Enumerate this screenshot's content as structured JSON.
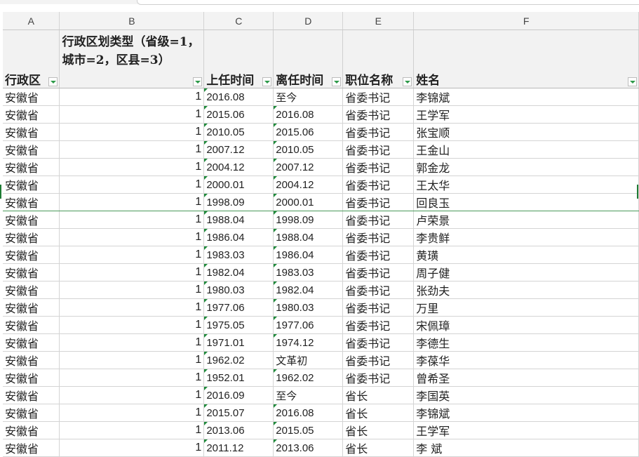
{
  "columns": [
    "A",
    "B",
    "C",
    "D",
    "E",
    "F"
  ],
  "headers": {
    "a": "行政区",
    "b": "行政区划类型（省级=1，城市=2，区县=3）",
    "c": "上任时间",
    "d": "离任时间",
    "e": "职位名称",
    "f": "姓名"
  },
  "rows": [
    {
      "region": "安徽省",
      "type": "1",
      "start": "2016.08",
      "end": "至今",
      "position": "省委书记",
      "name": "李锦斌"
    },
    {
      "region": "安徽省",
      "type": "1",
      "start": "2015.06",
      "end": "2016.08",
      "position": "省委书记",
      "name": "王学军"
    },
    {
      "region": "安徽省",
      "type": "1",
      "start": "2010.05",
      "end": "2015.06",
      "position": "省委书记",
      "name": "张宝顺"
    },
    {
      "region": "安徽省",
      "type": "1",
      "start": "2007.12",
      "end": "2010.05",
      "position": "省委书记",
      "name": "王金山"
    },
    {
      "region": "安徽省",
      "type": "1",
      "start": "2004.12",
      "end": "2007.12",
      "position": "省委书记",
      "name": "郭金龙"
    },
    {
      "region": "安徽省",
      "type": "1",
      "start": "2000.01",
      "end": "2004.12",
      "position": "省委书记",
      "name": "王太华"
    },
    {
      "region": "安徽省",
      "type": "1",
      "start": "1998.09",
      "end": "2000.01",
      "position": "省委书记",
      "name": "回良玉"
    },
    {
      "region": "安徽省",
      "type": "1",
      "start": "1988.04",
      "end": "1998.09",
      "position": "省委书记",
      "name": "卢荣景"
    },
    {
      "region": "安徽省",
      "type": "1",
      "start": "1986.04",
      "end": "1988.04",
      "position": "省委书记",
      "name": "李贵鲜"
    },
    {
      "region": "安徽省",
      "type": "1",
      "start": "1983.03",
      "end": "1986.04",
      "position": "省委书记",
      "name": "黄璜"
    },
    {
      "region": "安徽省",
      "type": "1",
      "start": "1982.04",
      "end": "1983.03",
      "position": "省委书记",
      "name": "周子健"
    },
    {
      "region": "安徽省",
      "type": "1",
      "start": "1980.03",
      "end": "1982.04",
      "position": "省委书记",
      "name": "张劲夫"
    },
    {
      "region": "安徽省",
      "type": "1",
      "start": "1977.06",
      "end": "1980.03",
      "position": "省委书记",
      "name": "万里"
    },
    {
      "region": "安徽省",
      "type": "1",
      "start": "1975.05",
      "end": "1977.06",
      "position": "省委书记",
      "name": "宋佩璋"
    },
    {
      "region": "安徽省",
      "type": "1",
      "start": "1971.01",
      "end": "1974.12",
      "position": "省委书记",
      "name": "李德生"
    },
    {
      "region": "安徽省",
      "type": "1",
      "start": "1962.02",
      "end": "文革初",
      "position": "省委书记",
      "name": "李葆华"
    },
    {
      "region": "安徽省",
      "type": "1",
      "start": "1952.01",
      "end": "1962.02",
      "position": "省委书记",
      "name": "曾希圣"
    },
    {
      "region": "安徽省",
      "type": "1",
      "start": "2016.09",
      "end": "至今",
      "position": "省长",
      "name": "李国英"
    },
    {
      "region": "安徽省",
      "type": "1",
      "start": "2015.07",
      "end": "2016.08",
      "position": "省长",
      "name": "李锦斌"
    },
    {
      "region": "安徽省",
      "type": "1",
      "start": "2013.06",
      "end": "2015.05",
      "position": "省长",
      "name": "王学军"
    },
    {
      "region": "安徽省",
      "type": "1",
      "start": "2011.12",
      "end": "2013.06",
      "position": "省长",
      "name": "李 斌"
    }
  ]
}
